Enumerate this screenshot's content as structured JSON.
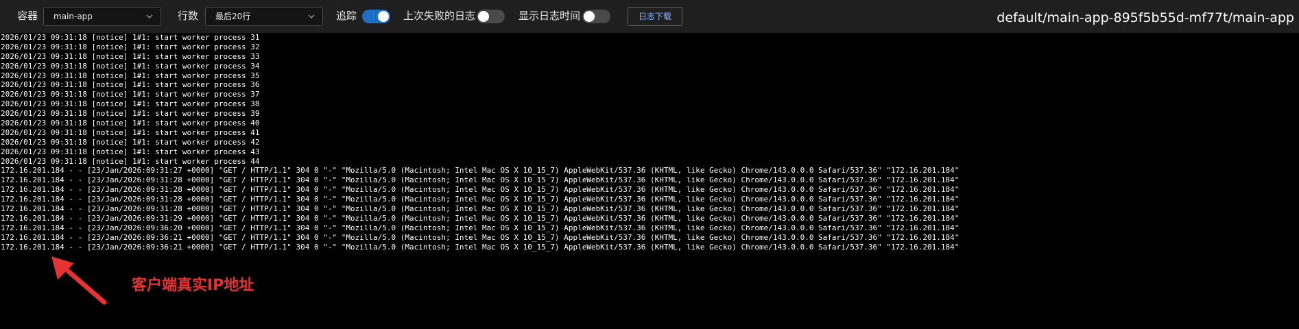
{
  "toolbar": {
    "container_label": "容器",
    "container_value": "main-app",
    "lines_label": "行数",
    "lines_value": "最后20行",
    "follow_label": "追踪",
    "follow_on": true,
    "previous_label": "上次失败的日志",
    "previous_on": false,
    "timestamps_label": "显示日志时间",
    "timestamps_on": false,
    "download_label": "日志下载",
    "pod_path": "default/main-app-895f5b55d-mf77t/main-app"
  },
  "colors": {
    "toolbar_bg": "#1f1f1f",
    "log_bg": "#000000",
    "log_text": "#ffffff",
    "switch_on": "#1f6fc5",
    "switch_off": "#4a4a4a",
    "download_text": "#8ab4ff",
    "annotation": "#e53333"
  },
  "log_lines": [
    "2026/01/23 09:31:18 [notice] 1#1: start worker process 31",
    "2026/01/23 09:31:18 [notice] 1#1: start worker process 32",
    "2026/01/23 09:31:18 [notice] 1#1: start worker process 33",
    "2026/01/23 09:31:18 [notice] 1#1: start worker process 34",
    "2026/01/23 09:31:18 [notice] 1#1: start worker process 35",
    "2026/01/23 09:31:18 [notice] 1#1: start worker process 36",
    "2026/01/23 09:31:18 [notice] 1#1: start worker process 37",
    "2026/01/23 09:31:18 [notice] 1#1: start worker process 38",
    "2026/01/23 09:31:18 [notice] 1#1: start worker process 39",
    "2026/01/23 09:31:18 [notice] 1#1: start worker process 40",
    "2026/01/23 09:31:18 [notice] 1#1: start worker process 41",
    "2026/01/23 09:31:18 [notice] 1#1: start worker process 42",
    "2026/01/23 09:31:18 [notice] 1#1: start worker process 43",
    "2026/01/23 09:31:18 [notice] 1#1: start worker process 44",
    "172.16.201.184 - - [23/Jan/2026:09:31:27 +0000] \"GET / HTTP/1.1\" 304 0 \"-\" \"Mozilla/5.0 (Macintosh; Intel Mac OS X 10_15_7) AppleWebKit/537.36 (KHTML, like Gecko) Chrome/143.0.0.0 Safari/537.36\" \"172.16.201.184\"",
    "172.16.201.184 - - [23/Jan/2026:09:31:28 +0000] \"GET / HTTP/1.1\" 304 0 \"-\" \"Mozilla/5.0 (Macintosh; Intel Mac OS X 10_15_7) AppleWebKit/537.36 (KHTML, like Gecko) Chrome/143.0.0.0 Safari/537.36\" \"172.16.201.184\"",
    "172.16.201.184 - - [23/Jan/2026:09:31:28 +0000] \"GET / HTTP/1.1\" 304 0 \"-\" \"Mozilla/5.0 (Macintosh; Intel Mac OS X 10_15_7) AppleWebKit/537.36 (KHTML, like Gecko) Chrome/143.0.0.0 Safari/537.36\" \"172.16.201.184\"",
    "172.16.201.184 - - [23/Jan/2026:09:31:28 +0000] \"GET / HTTP/1.1\" 304 0 \"-\" \"Mozilla/5.0 (Macintosh; Intel Mac OS X 10_15_7) AppleWebKit/537.36 (KHTML, like Gecko) Chrome/143.0.0.0 Safari/537.36\" \"172.16.201.184\"",
    "172.16.201.184 - - [23/Jan/2026:09:31:28 +0000] \"GET / HTTP/1.1\" 304 0 \"-\" \"Mozilla/5.0 (Macintosh; Intel Mac OS X 10_15_7) AppleWebKit/537.36 (KHTML, like Gecko) Chrome/143.0.0.0 Safari/537.36\" \"172.16.201.184\"",
    "172.16.201.184 - - [23/Jan/2026:09:31:29 +0000] \"GET / HTTP/1.1\" 304 0 \"-\" \"Mozilla/5.0 (Macintosh; Intel Mac OS X 10_15_7) AppleWebKit/537.36 (KHTML, like Gecko) Chrome/143.0.0.0 Safari/537.36\" \"172.16.201.184\"",
    "172.16.201.184 - - [23/Jan/2026:09:36:20 +0000] \"GET / HTTP/1.1\" 304 0 \"-\" \"Mozilla/5.0 (Macintosh; Intel Mac OS X 10_15_7) AppleWebKit/537.36 (KHTML, like Gecko) Chrome/143.0.0.0 Safari/537.36\" \"172.16.201.184\"",
    "172.16.201.184 - - [23/Jan/2026:09:36:21 +0000] \"GET / HTTP/1.1\" 304 0 \"-\" \"Mozilla/5.0 (Macintosh; Intel Mac OS X 10_15_7) AppleWebKit/537.36 (KHTML, like Gecko) Chrome/143.0.0.0 Safari/537.36\" \"172.16.201.184\"",
    "172.16.201.184 - - [23/Jan/2026:09:36:21 +0000] \"GET / HTTP/1.1\" 304 0 \"-\" \"Mozilla/5.0 (Macintosh; Intel Mac OS X 10_15_7) AppleWebKit/537.36 (KHTML, like Gecko) Chrome/143.0.0.0 Safari/537.36\" \"172.16.201.184\""
  ],
  "annotation": {
    "text": "客户端真实IP地址",
    "icon": "red-arrow-icon"
  }
}
